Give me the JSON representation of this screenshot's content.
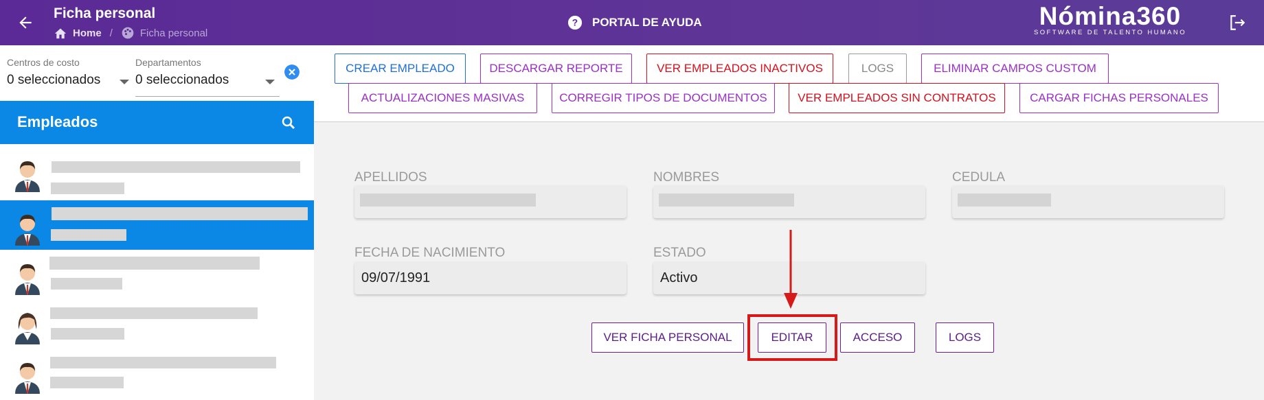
{
  "header": {
    "title": "Ficha personal",
    "breadcrumb_home": "Home",
    "breadcrumb_current": "Ficha personal",
    "help_label": "PORTAL DE AYUDA",
    "brand_name": "Nómina360",
    "brand_tagline": "SOFTWARE DE TALENTO HUMANO"
  },
  "filters": {
    "cost_centers_label": "Centros de costo",
    "cost_centers_value": "0 seleccionados",
    "departments_label": "Departamentos",
    "departments_value": "0 seleccionados"
  },
  "employees_panel": {
    "title": "Empleados",
    "selected_index": 1,
    "rows": 5
  },
  "toolbar": {
    "crear_empleado": "CREAR EMPLEADO",
    "descargar_reporte": "DESCARGAR REPORTE",
    "ver_inactivos": "VER EMPLEADOS INACTIVOS",
    "logs": "LOGS",
    "eliminar_campos": "ELIMINAR CAMPOS CUSTOM",
    "actualizaciones": "ACTUALIZACIONES MASIVAS",
    "corregir_tipos": "CORREGIR TIPOS DE DOCUMENTOS",
    "ver_sin_contratos": "VER EMPLEADOS SIN CONTRATOS",
    "cargar_fichas": "CARGAR FICHAS PERSONALES"
  },
  "form": {
    "apellidos_label": "APELLIDOS",
    "nombres_label": "NOMBRES",
    "cedula_label": "CEDULA",
    "fecha_label": "FECHA DE NACIMIENTO",
    "fecha_value": "09/07/1991",
    "estado_label": "ESTADO",
    "estado_value": "Activo"
  },
  "actions": {
    "ver_ficha": "VER FICHA PERSONAL",
    "editar": "EDITAR",
    "acceso": "ACCESO",
    "logs": "LOGS"
  },
  "colors": {
    "header": "#5b2a96",
    "primary_blue": "#0b87e5",
    "purple": "#9b2fc7",
    "red": "#d6101c",
    "highlight": "#d61a1a"
  }
}
